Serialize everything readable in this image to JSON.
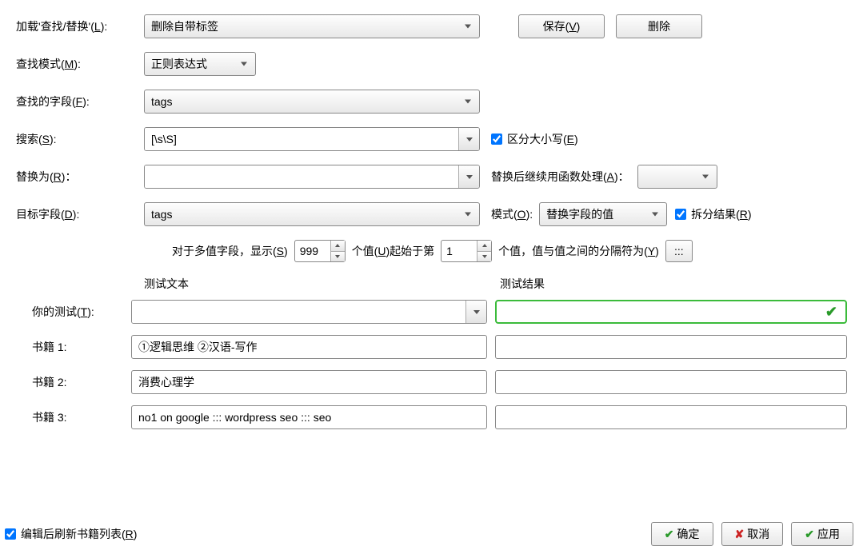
{
  "load": {
    "label_pre": "加载'查找/替换'(",
    "hotkey": "L",
    "label_post": "):",
    "value": "删除自带标签",
    "save_pre": "保存(",
    "save_hotkey": "V",
    "save_post": ")",
    "delete": "删除"
  },
  "mode": {
    "label_pre": "查找模式(",
    "hotkey": "M",
    "label_post": "):",
    "value": "正则表达式"
  },
  "field": {
    "label_pre": "查找的字段(",
    "hotkey": "F",
    "label_post": "):",
    "value": "tags"
  },
  "search": {
    "label_pre": "搜索(",
    "hotkey": "S",
    "label_post": "):",
    "value": "[\\s\\S]",
    "case_pre": "区分大小写(",
    "case_hotkey": "E",
    "case_post": ")"
  },
  "replace": {
    "label_pre": "替换为(",
    "hotkey": "R",
    "label_post": ")：",
    "value": "",
    "func_pre": "替换后继续用函数处理(",
    "func_hotkey": "A",
    "func_post": ")："
  },
  "dest": {
    "label_pre": "目标字段(",
    "hotkey": "D",
    "label_post": "):",
    "value": "tags",
    "mode_pre": "模式(",
    "mode_hotkey": "O",
    "mode_post": "):",
    "mode_value": "替换字段的值",
    "split_pre": "拆分结果(",
    "split_hotkey": "R",
    "split_post": ")"
  },
  "multi": {
    "p1_pre": "对于多值字段，显示(",
    "p1_hotkey": "S",
    "p1_post": ")",
    "show_n": "999",
    "p2_pre": "个值(",
    "p2_hotkey": "U",
    "p2_post": ")起始于第",
    "start_n": "1",
    "p3_pre": "个值，值与值之间的分隔符为(",
    "p3_hotkey": "Y",
    "p3_post": ")",
    "sep": ":::"
  },
  "test": {
    "text_label": "测试文本",
    "result_label": "测试结果",
    "your_pre": "你的测试(",
    "your_hotkey": "T",
    "your_post": "):",
    "your_value": "",
    "book1_label": "书籍 1:",
    "book1_value": "①逻辑思维 ②汉语-写作",
    "book2_label": "书籍 2:",
    "book2_value": "消费心理学",
    "book3_label": "书籍 3:",
    "book3_value": "no1 on google ::: wordpress seo ::: seo"
  },
  "footer": {
    "refresh_pre": "编辑后刷新书籍列表(",
    "refresh_hotkey": "R",
    "refresh_post": ")",
    "ok": "确定",
    "cancel": "取消",
    "apply": "应用"
  }
}
